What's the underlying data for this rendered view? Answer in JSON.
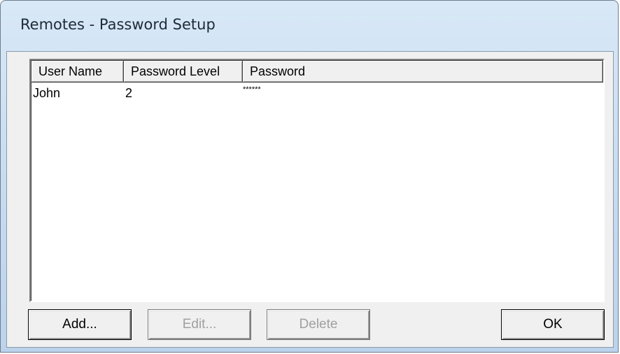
{
  "window": {
    "title": "Remotes - Password Setup"
  },
  "list": {
    "columns": [
      "User Name",
      "Password Level",
      "Password"
    ],
    "rows": [
      {
        "user": "John",
        "level": "2",
        "password": "******"
      }
    ]
  },
  "buttons": {
    "add": "Add...",
    "edit": "Edit...",
    "delete": "Delete",
    "ok": "OK"
  }
}
